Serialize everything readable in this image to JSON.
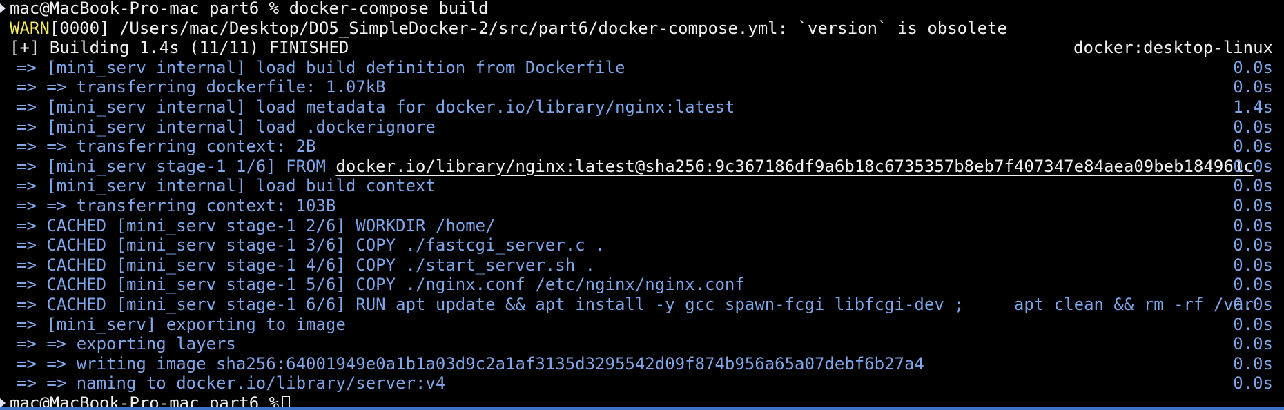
{
  "terminal": {
    "prompt_line": "mac@MacBook-Pro-mac part6 % docker-compose build",
    "warn_tag": "WARN",
    "warn_text": "[0000] /Users/mac/Desktop/DO5_SimpleDocker-2/src/part6/docker-compose.yml: `version` is obsolete",
    "building_text": "[+] Building 1.4s (11/11) FINISHED",
    "builder_name": "docker:desktop-linux",
    "steps": [
      {
        "text": "=> [mini_serv internal] load build definition from Dockerfile",
        "time": "0.0s"
      },
      {
        "text": "=> => transferring dockerfile: 1.07kB",
        "time": "0.0s"
      },
      {
        "text": "=> [mini_serv internal] load metadata for docker.io/library/nginx:latest",
        "time": "1.4s"
      },
      {
        "text": "=> [mini_serv internal] load .dockerignore",
        "time": "0.0s"
      },
      {
        "text": "=> => transferring context: 2B",
        "time": "0.0s"
      },
      {
        "text_before": "=> [mini_serv stage-1 1/6] FROM ",
        "link": "docker.io/library/nginx:latest@sha256:9c367186df9a6b18c6735357b8eb7f407347e84aea09beb184961c",
        "time": "0.0s"
      },
      {
        "text": "=> [mini_serv internal] load build context",
        "time": "0.0s"
      },
      {
        "text": "=> => transferring context: 103B",
        "time": "0.0s"
      },
      {
        "text": "=> CACHED [mini_serv stage-1 2/6] WORKDIR /home/",
        "time": "0.0s"
      },
      {
        "text": "=> CACHED [mini_serv stage-1 3/6] COPY ./fastcgi_server.c .",
        "time": "0.0s"
      },
      {
        "text": "=> CACHED [mini_serv stage-1 4/6] COPY ./start_server.sh .",
        "time": "0.0s"
      },
      {
        "text": "=> CACHED [mini_serv stage-1 5/6] COPY ./nginx.conf /etc/nginx/nginx.conf",
        "time": "0.0s"
      },
      {
        "text": "=> CACHED [mini_serv stage-1 6/6] RUN apt update && apt install -y gcc spawn-fcgi libfcgi-dev ;     apt clean && rm -rf /var",
        "time": "0.0s"
      },
      {
        "text": "=> [mini_serv] exporting to image",
        "time": "0.0s"
      },
      {
        "text": "=> => exporting layers",
        "time": "0.0s"
      },
      {
        "text": "=> => writing image sha256:64001949e0a1b1a03d9c2a1af3135d3295542d09f874b956a65a07debf6b27a4",
        "time": "0.0s"
      },
      {
        "text": "=> => naming to docker.io/library/server:v4",
        "time": "0.0s"
      }
    ],
    "final_prompt": "mac@MacBook-Pro-mac part6 %",
    "colors": {
      "background": "#000000",
      "text": "#f1f1f1",
      "step_blue": "#7ea6e8",
      "warn_yellow": "#f3ee5a",
      "bottom_bar": "#3a73c7"
    }
  }
}
